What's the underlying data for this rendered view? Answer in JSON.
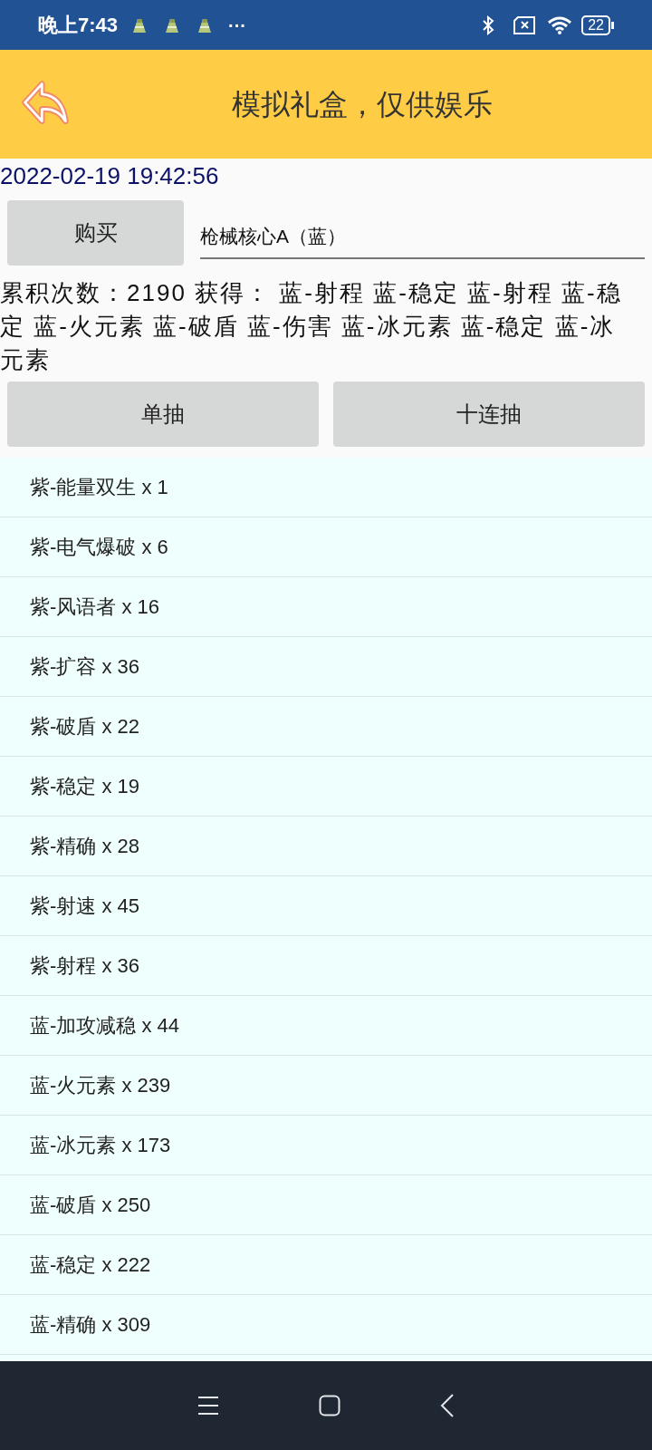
{
  "status_bar": {
    "time": "晚上7:43",
    "more": "···",
    "battery": "22"
  },
  "header": {
    "title": "模拟礼盒，仅供娱乐"
  },
  "timestamp": "2022-02-19 19:42:56",
  "buy_button": "购买",
  "item_field": {
    "value": "枪械核心A（蓝）"
  },
  "result": "累积次数：2190 获得：  蓝-射程 蓝-稳定 蓝-射程 蓝-稳定 蓝-火元素 蓝-破盾 蓝-伤害 蓝-冰元素 蓝-稳定 蓝-冰元素",
  "draw_buttons": [
    "单抽",
    "十连抽"
  ],
  "items": [
    "紫-能量双生 x 1",
    "紫-电气爆破 x 6",
    "紫-风语者 x 16",
    "紫-扩容 x 36",
    "紫-破盾 x 22",
    "紫-稳定 x 19",
    "紫-精确 x 28",
    "紫-射速 x 45",
    "紫-射程 x 36",
    "蓝-加攻减稳 x 44",
    "蓝-火元素 x 239",
    "蓝-冰元素 x 173",
    "蓝-破盾 x 250",
    "蓝-稳定 x 222",
    "蓝-精确 x 309"
  ]
}
